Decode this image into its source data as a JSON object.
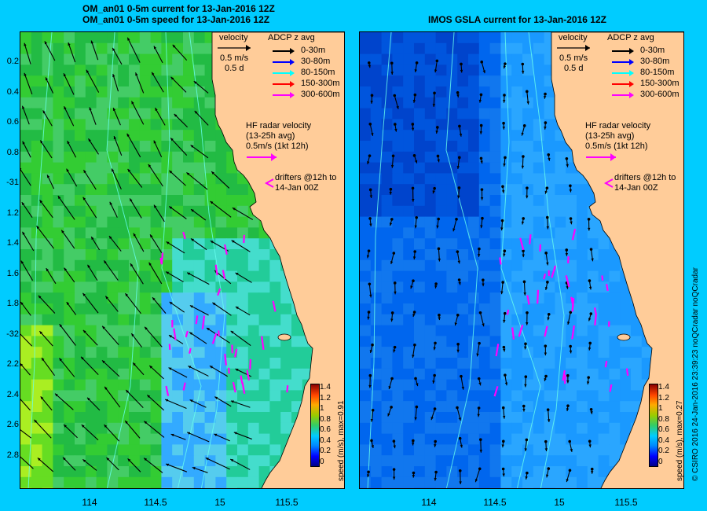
{
  "left_title": [
    "OM_an01 0-5m current for 13-Jan-2016 12Z",
    "OM_an01 0-5m speed for 13-Jan-2016 12Z"
  ],
  "right_title": "IMOS GSLA current for 13-Jan-2016 12Z",
  "legend": {
    "velocity": "velocity",
    "scale_speed": "0.5 m/s",
    "scale_time": "0.5 d",
    "adcp_title": "ADCP z avg",
    "adcp_items": [
      {
        "label": "0-30m",
        "color": "#000000"
      },
      {
        "label": "30-80m",
        "color": "#0000ff"
      },
      {
        "label": "80-150m",
        "color": "#00ffff"
      },
      {
        "label": "150-300m",
        "color": "#ff0000"
      },
      {
        "label": "300-600m",
        "color": "#ff00ff"
      }
    ],
    "hf_title": "HF radar velocity",
    "hf_avg": "(13-25h avg)",
    "hf_scale": "0.5m/s (1kt 12h)",
    "drifters_line1": "drifters @12h to",
    "drifters_line2": "14-Jan 00Z"
  },
  "yticks": [
    "0.2",
    "0.4",
    "0.6",
    "0.8",
    "-31",
    "1.2",
    "1.4",
    "1.6",
    "1.8",
    "-32",
    "2.2",
    "2.4",
    "2.6",
    "2.8"
  ],
  "xticks": [
    "114",
    "114.5",
    "15",
    "115.5"
  ],
  "colorbar": {
    "ticks": [
      "1.4",
      "1.2",
      "1",
      "0.8",
      "0.6",
      "0.4",
      "0.2",
      "0"
    ],
    "left_label": "speed (m/s), max=0.91",
    "right_label": "speed (m/s), max=0.27"
  },
  "credit": "© CSIRO 2016   24-Jan-2016 23:39:23 noQCradar noQCradar",
  "colors": {
    "background": "#00ccff",
    "land": "#ffcc99",
    "left_field": "#33cc33",
    "right_field": "#0077ee"
  }
}
